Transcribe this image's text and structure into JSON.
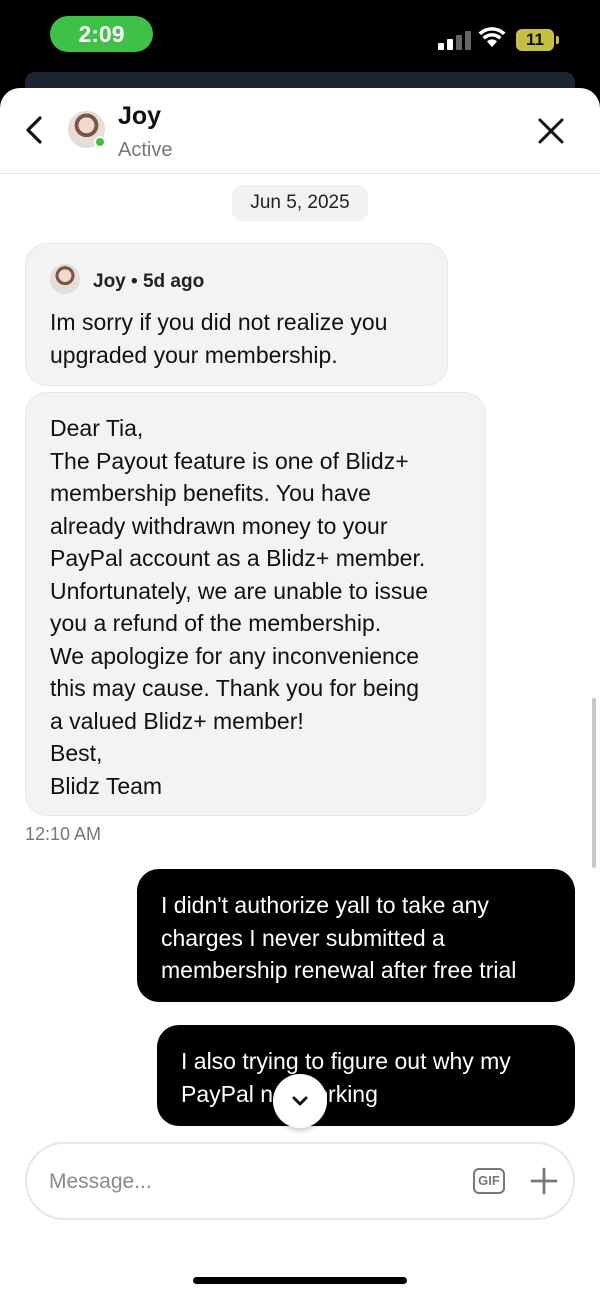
{
  "status_bar": {
    "time": "2:09",
    "battery_level": "11"
  },
  "header": {
    "name": "Joy",
    "status": "Active",
    "back_icon": "chevron-left-icon",
    "close_icon": "close-icon"
  },
  "conversation": {
    "date_label": "Jun 5, 2025",
    "messages": [
      {
        "direction": "incoming",
        "sender_meta": "Joy • 5d ago",
        "lines": [
          "Im sorry if you did not realize you",
          "upgraded your membership."
        ]
      },
      {
        "direction": "incoming",
        "lines": [
          "Dear Tia,",
          "The Payout feature is one of Blidz+",
          "membership benefits. You have",
          "already withdrawn money to your",
          "PayPal account as a Blidz+ member.",
          "Unfortunately, we are unable to issue",
          "you a refund of the membership.",
          "We apologize for any inconvenience",
          "this may cause. Thank you for being",
          "a valued Blidz+ member!",
          "Best,",
          "Blidz Team"
        ]
      },
      {
        "direction": "outgoing",
        "lines": [
          "I didn't authorize yall to take any",
          "charges I never submitted a",
          "membership renewal after free trial"
        ]
      },
      {
        "direction": "outgoing",
        "lines": [
          "I also trying to figure out why my",
          "PayPal not working"
        ]
      }
    ],
    "timestamp": "12:10 AM"
  },
  "composer": {
    "placeholder": "Message...",
    "gif_label": "GIF",
    "plus_icon": "plus-icon"
  },
  "colors": {
    "accent_green": "#3ec146",
    "outgoing_bubble": "#000000",
    "incoming_bubble": "#f3f3f3"
  }
}
